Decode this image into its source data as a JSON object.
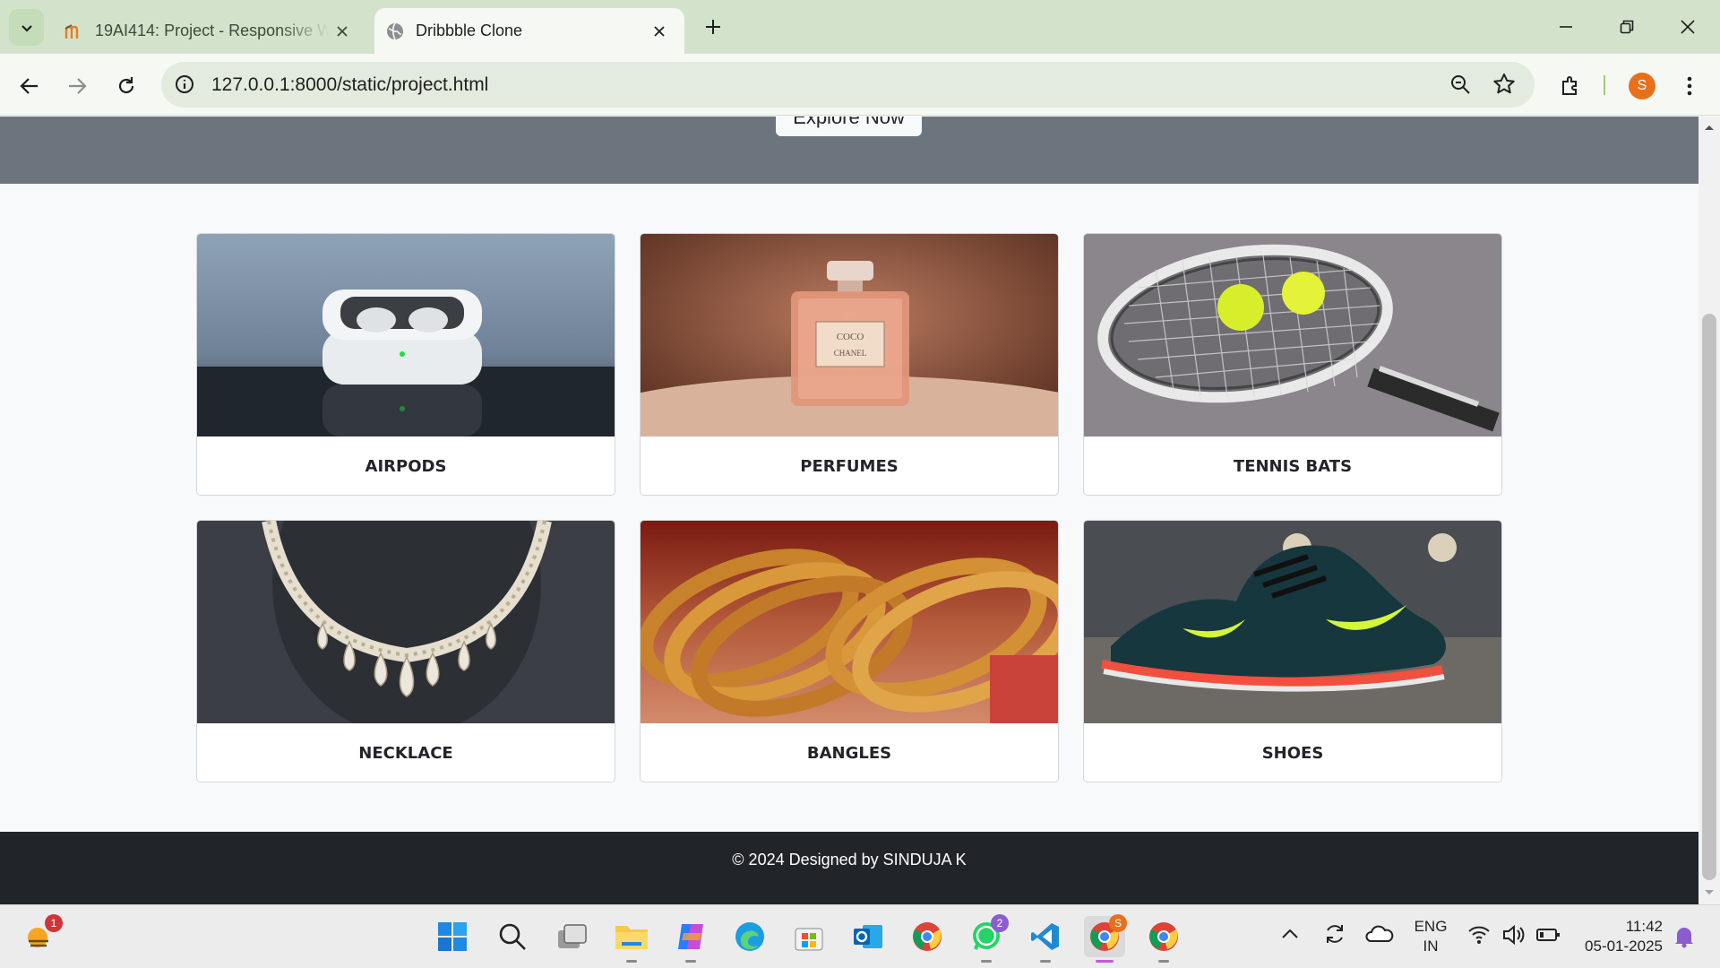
{
  "browser": {
    "tabs": [
      {
        "title": "19AI414: Project - Responsive W",
        "icon": "moodle-icon",
        "active": false
      },
      {
        "title": "Dribbble Clone",
        "icon": "globe-icon",
        "active": true
      }
    ],
    "url": "127.0.0.1:8000/static/project.html",
    "profile_initial": "S",
    "accent": "#d3e3cb"
  },
  "page": {
    "hero_button": "Explore Now",
    "cards": [
      {
        "label": "AIRPODS",
        "image": "airpods-image"
      },
      {
        "label": "PERFUMES",
        "image": "perfume-image"
      },
      {
        "label": "TENNIS BATS",
        "image": "tennis-racket-image"
      },
      {
        "label": "NECKLACE",
        "image": "necklace-image"
      },
      {
        "label": "BANGLES",
        "image": "bangles-image"
      },
      {
        "label": "SHOES",
        "image": "shoes-image"
      }
    ],
    "footer": "© 2024 Designed by SINDUJA K"
  },
  "taskbar": {
    "weather_badge": "1",
    "whatsapp_badge": "2",
    "chrome_badge": "S",
    "lang_top": "ENG",
    "lang_bottom": "IN",
    "time": "11:42",
    "date": "05-01-2025"
  }
}
